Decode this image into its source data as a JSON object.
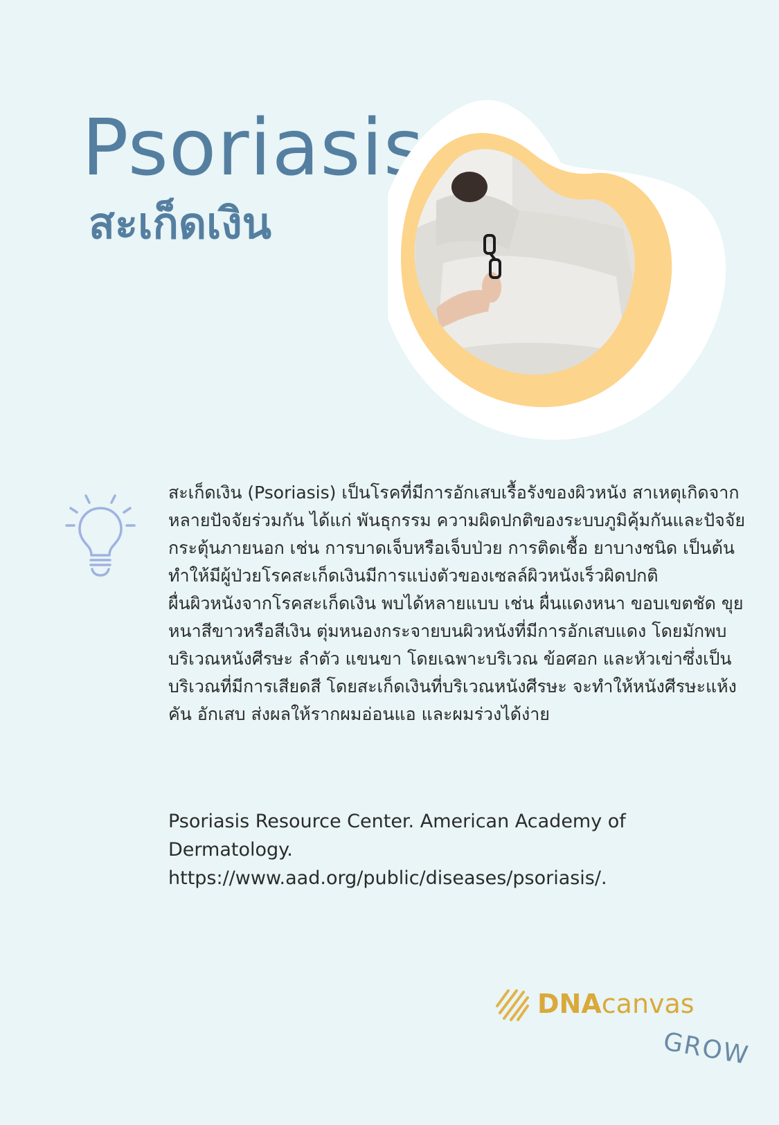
{
  "header": {
    "title_en": "Psoriasis",
    "title_th": "สะเก็ดเงิน"
  },
  "hero_image": {
    "description_icon": "person-in-bed-photo"
  },
  "content": {
    "icon": "lightbulb-icon",
    "paragraphs": [
      "สะเก็ดเงิน (Psoriasis) เป็นโรคที่มีการอักเสบเรื้อรังของผิวหนัง สาเหตุเกิดจากหลายปัจจัยร่วมกัน ได้แก่ พันธุกรรม ความผิดปกติของระบบภูมิคุ้มกันและปัจจัยกระตุ้นภายนอก เช่น การบาดเจ็บหรือเจ็บป่วย การติดเชื้อ ยาบางชนิด เป็นต้น ทำให้มีผู้ป่วยโรคสะเก็ดเงินมีการแบ่งตัวของเซลล์ผิวหนังเร็วผิดปกติ",
      "ผื่นผิวหนังจากโรคสะเก็ดเงิน พบได้หลายแบบ เช่น ผื่นแดงหนา ขอบเขตชัด ขุยหนาสีขาวหรือสีเงิน ตุ่มหนองกระจายบนผิวหนังที่มีการอักเสบแดง โดยมักพบบริเวณหนังศีรษะ ลำตัว แขนขา โดยเฉพาะบริเวณ ข้อศอก และหัวเข่าซึ่งเป็นบริเวณที่มีการเสียดสี โดยสะเก็ดเงินที่บริเวณหนังศีรษะ จะทำให้หนังศีรษะแห้ง คัน อักเสบ ส่งผลให้รากผมอ่อนแอ และผมร่วงได้ง่าย"
    ]
  },
  "reference": {
    "line1": "Psoriasis Resource Center. American Academy of",
    "line2": "Dermatology.",
    "line3": "https://www.aad.org/public/diseases/psoriasis/."
  },
  "brand": {
    "logo_strong": "DNA",
    "logo_light": "canvas",
    "tagline": "GROW"
  },
  "colors": {
    "background": "#e9f5f6",
    "title": "#557fa0",
    "accent": "#fcd48b",
    "brand": "#d9a93a"
  }
}
